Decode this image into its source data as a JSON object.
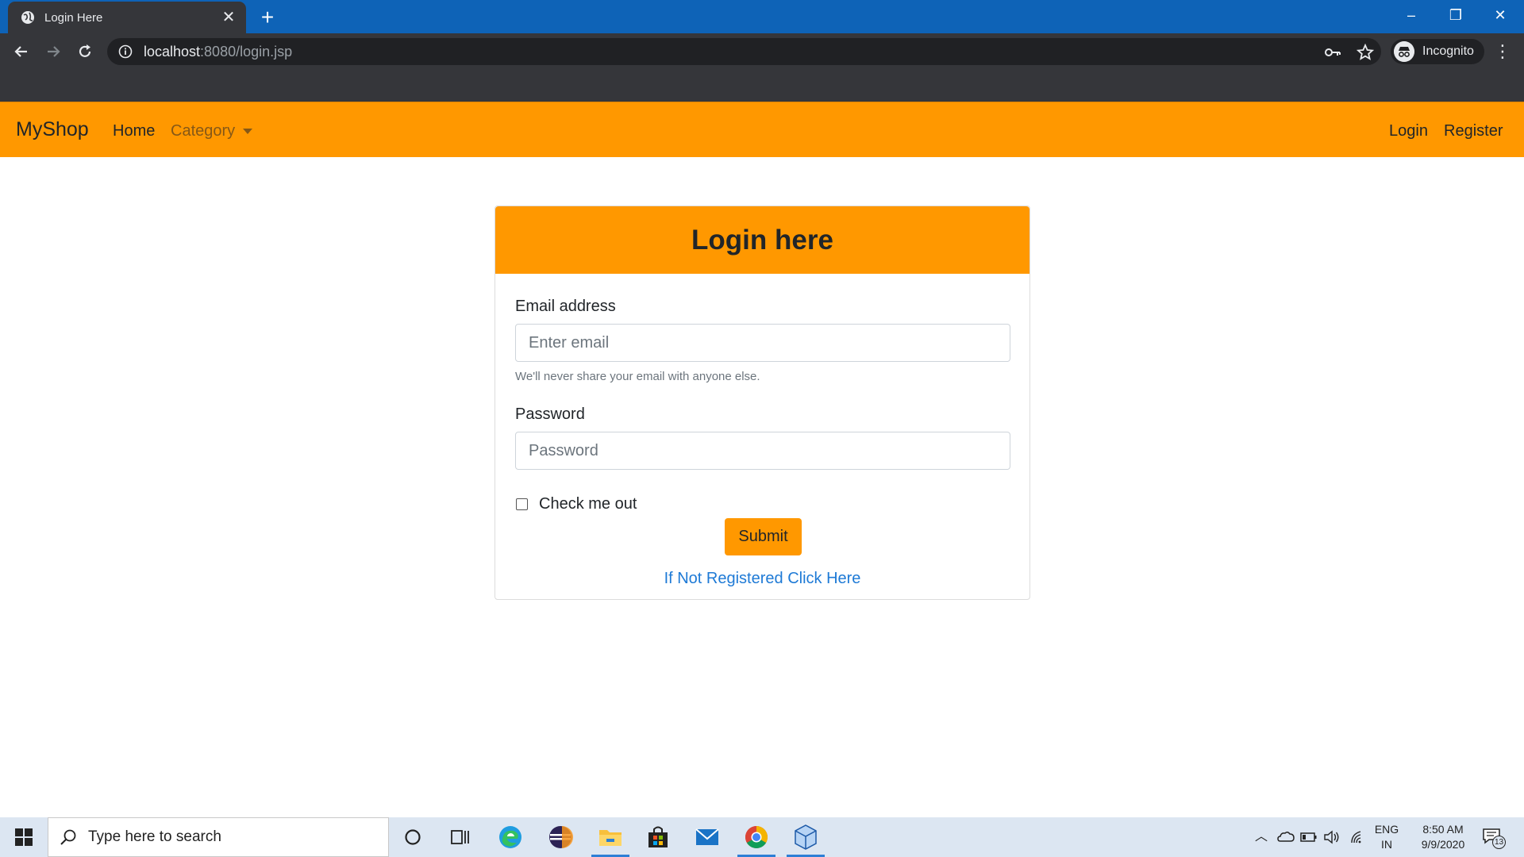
{
  "browser": {
    "tab_title": "Login Here",
    "url_host": "localhost",
    "url_path": ":8080/login.jsp",
    "profile_label": "Incognito",
    "tab_close": "✕",
    "new_tab": "+",
    "window_controls": [
      "–",
      "❐",
      "✕"
    ]
  },
  "navbar": {
    "brand": "MyShop",
    "links": {
      "home": "Home",
      "category": "Category",
      "login": "Login",
      "register": "Register"
    },
    "color": "#ff9800"
  },
  "login_card": {
    "title": "Login here",
    "email_label": "Email address",
    "email_placeholder": "Enter email",
    "email_help": "We'll never share your email with anyone else.",
    "password_label": "Password",
    "password_placeholder": "Password",
    "checkbox_label": "Check me out",
    "checkbox_checked": false,
    "submit_label": "Submit",
    "register_link": "If Not Registered Click Here"
  },
  "taskbar": {
    "search_placeholder": "Type here to search",
    "language": "ENG",
    "region": "IN",
    "time": "8:50 AM",
    "date": "9/9/2020",
    "notification_count": "13",
    "apps": [
      "cortana-icon",
      "task-view-icon",
      "edge-icon",
      "eclipse-icon",
      "file-explorer-icon",
      "store-icon",
      "mail-icon",
      "chrome-icon",
      "virtualbox-icon"
    ]
  },
  "colors": {
    "tab_strip": "#0e63b7",
    "toolbar": "#35363a",
    "accent": "#ff9800",
    "link": "#1e7ad6"
  }
}
